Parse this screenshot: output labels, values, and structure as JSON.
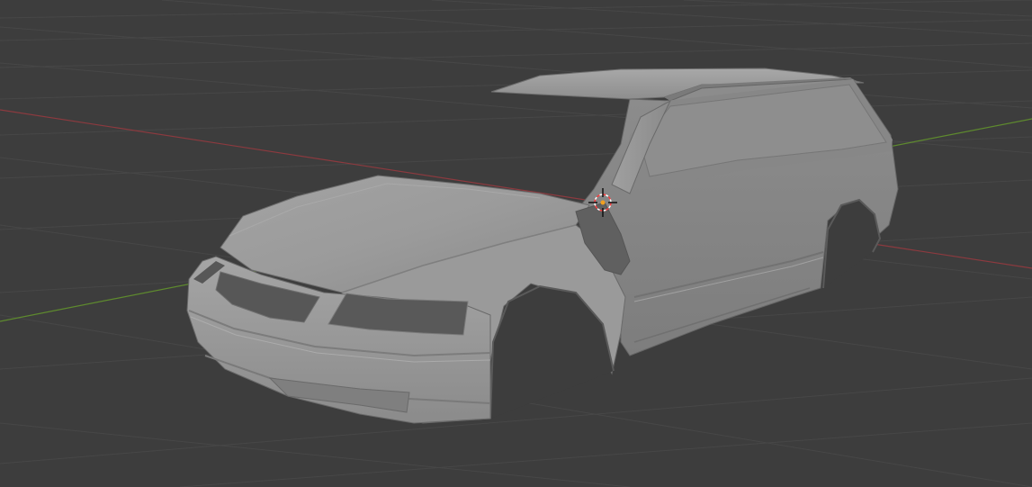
{
  "viewport": {
    "background_color": "#3d3d3d",
    "grid_color": "#474747",
    "axis_x_color": "#8c3a3f",
    "axis_y_color": "#5e8a2e",
    "object_color": "#9a9a9a"
  },
  "object": {
    "shading": "solid"
  },
  "cursor_3d": {
    "icon": "3d-cursor-icon"
  }
}
